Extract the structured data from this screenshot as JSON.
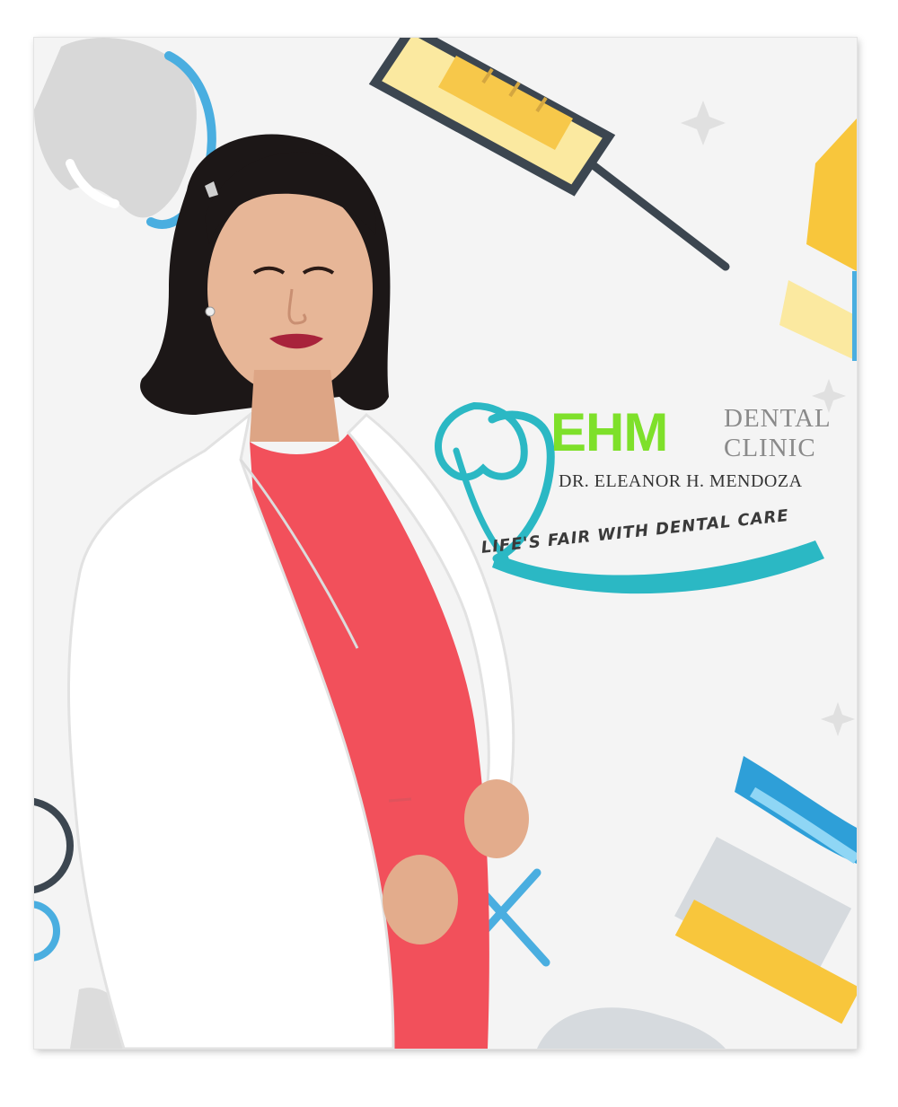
{
  "logo": {
    "brand": "EHM",
    "word1": "DENTAL",
    "word2": "CLINIC",
    "doctor_name": "DR. ELEANOR H. MENDOZA",
    "tagline": "LIFE'S FAIR WITH DENTAL CARE"
  },
  "colors": {
    "brand_green": "#7ee02a",
    "brand_teal": "#2bb8c4",
    "clinic_gray": "#8a8a8a",
    "blouse_red": "#f2505b",
    "coat_white": "#ffffff",
    "background": "#f4f4f4"
  },
  "icons": [
    "syringe-icon",
    "toothpaste-icon",
    "toothbrush-icon",
    "tooth-icon",
    "mirror-icon",
    "sparkle-icon"
  ]
}
